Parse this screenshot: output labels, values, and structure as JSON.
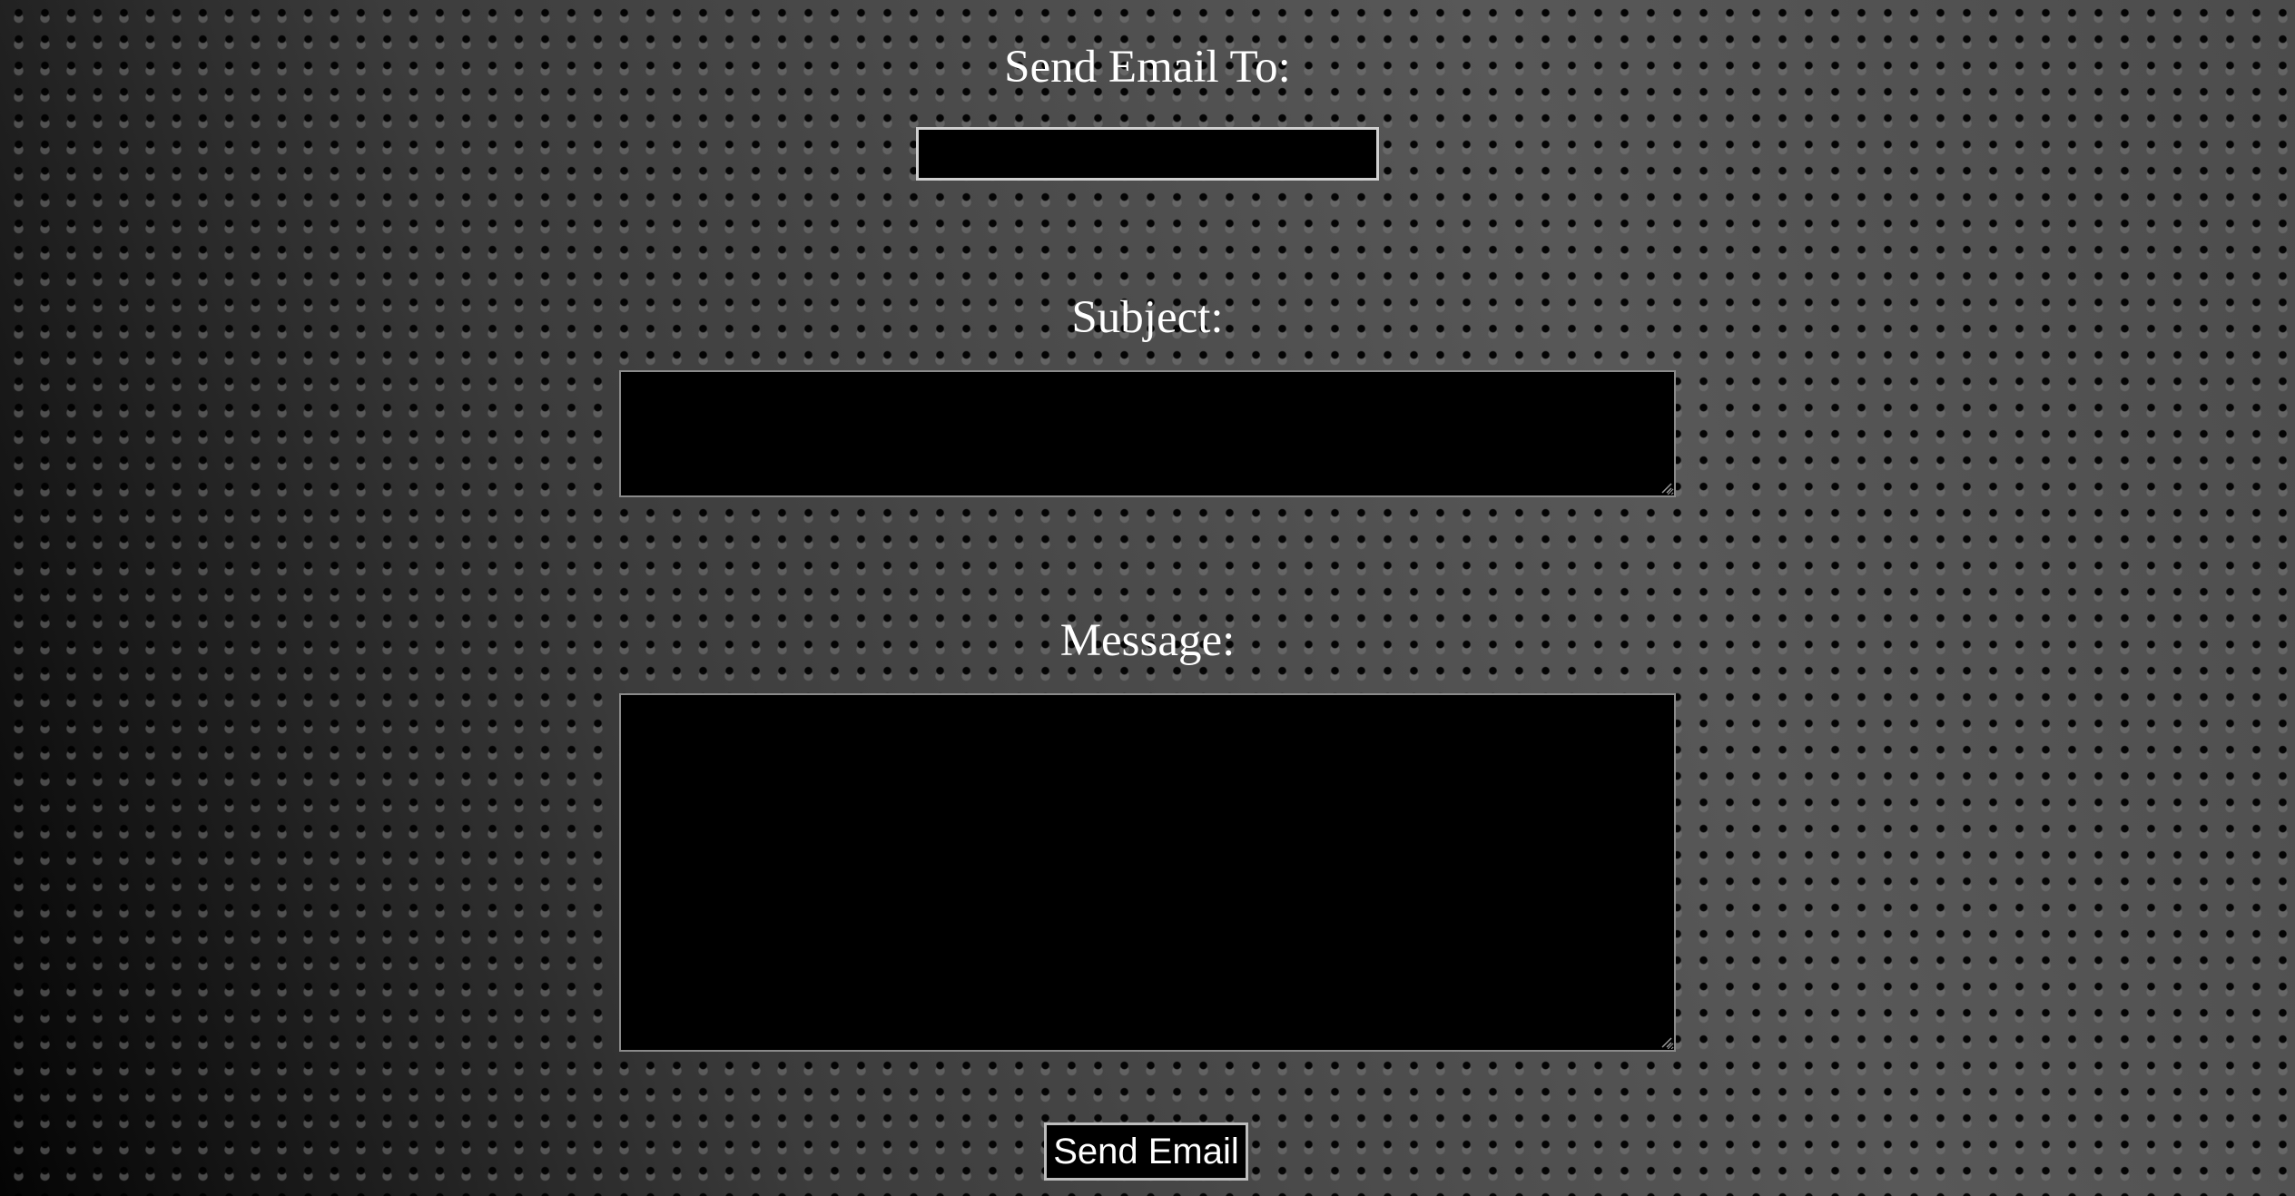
{
  "form": {
    "to_label": "Send Email To:",
    "to_value": "",
    "subject_label": "Subject:",
    "subject_value": "",
    "message_label": "Message:",
    "message_value": "",
    "submit_label": "Send Email"
  },
  "colors": {
    "field_background": "#000000",
    "text": "#ffffff",
    "field_border": "#cfcfcf"
  },
  "icons": {
    "textarea_resize": "resize-grip-icon"
  }
}
